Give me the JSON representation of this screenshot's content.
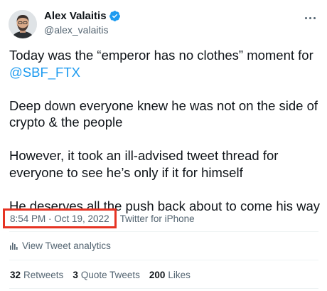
{
  "author": {
    "display_name": "Alex Valaitis",
    "handle": "@alex_valaitis",
    "verified": true,
    "avatar_icon": "avatar-photo-icon"
  },
  "tweet": {
    "line1_prefix": "Today was the “emperor has no clothes” moment for",
    "line1_mention": "@SBF_FTX",
    "para2": "Deep down everyone knew he was not on the side of crypto & the people",
    "para3": "However, it took an ill-advised tweet thread for everyone to see he’s only if it for himself",
    "para4": "He deserves all the push back about to come his way"
  },
  "meta": {
    "timestamp": "8:54 PM · Oct 19, 2022",
    "client": "Twitter for iPhone"
  },
  "analytics": {
    "label": "View Tweet analytics"
  },
  "stats": {
    "retweets_count": "32",
    "retweets_label": "Retweets",
    "quotes_count": "3",
    "quotes_label": "Quote Tweets",
    "likes_count": "200",
    "likes_label": "Likes"
  },
  "colors": {
    "accent": "#1d9bf0",
    "text": "#0f1419",
    "secondary": "#536471",
    "highlight_box": "#e63323"
  }
}
